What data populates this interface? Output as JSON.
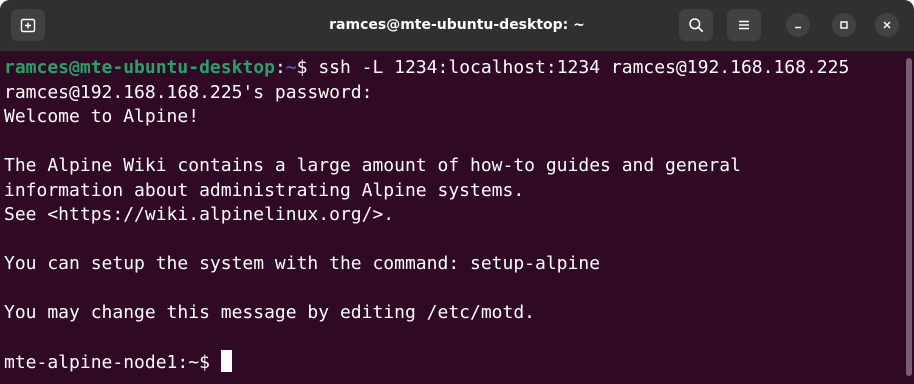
{
  "window": {
    "title": "ramces@mte-ubuntu-desktop: ~"
  },
  "icons": {
    "new_tab": "new-tab-icon",
    "search": "search-icon",
    "menu": "hamburger-menu-icon",
    "minimize": "minimize-icon",
    "maximize": "maximize-icon",
    "close": "close-icon"
  },
  "terminal": {
    "prompt1": {
      "user_host": "ramces@mte-ubuntu-desktop",
      "colon": ":",
      "path": "~",
      "symbol": "$ ",
      "command": "ssh -L 1234:localhost:1234 ramces@192.168.168.225"
    },
    "lines": [
      "ramces@192.168.168.225's password:",
      "Welcome to Alpine!",
      "",
      "The Alpine Wiki contains a large amount of how-to guides and general",
      "information about administrating Alpine systems.",
      "See <https://wiki.alpinelinux.org/>.",
      "",
      "You can setup the system with the command: setup-alpine",
      "",
      "You may change this message by editing /etc/motd.",
      ""
    ],
    "prompt2": "mte-alpine-node1:~$ "
  },
  "colors": {
    "background": "#300a24",
    "titlebar": "#303030",
    "user_host": "#26a269",
    "path": "#3465a4",
    "text": "#ffffff"
  }
}
